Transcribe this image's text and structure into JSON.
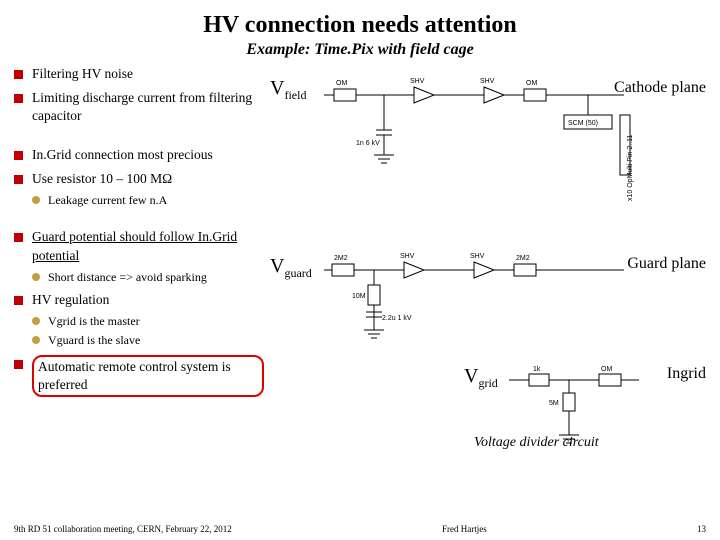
{
  "title": "HV connection needs attention",
  "subtitle": "Example: Time.Pix with field cage",
  "bullets": {
    "b0": "Filtering HV noise",
    "b1": "Limiting discharge current from filtering capacitor",
    "b2": "In.Grid connection most precious",
    "b3": "Use resistor 10 – 100 MΩ",
    "b3s0": "Leakage current few n.A",
    "b4": "Guard potential should follow In.Grid potential",
    "b4s0": "Short distance => avoid sparking",
    "b5": "HV regulation",
    "b5s0": "Vgrid is the master",
    "b5s1": "Vguard is the slave",
    "b6": "Automatic remote control system is preferred"
  },
  "vlabels": {
    "field": "field",
    "guard": "guard",
    "grid": "grid"
  },
  "planes": {
    "cathode": "Cathode plane",
    "guard": "Guard plane",
    "ingrid": "Ingrid"
  },
  "caption": "Voltage divider circuit",
  "schem": {
    "r_om": "OM",
    "r_shv": "SHV",
    "r_2m2": "2M2",
    "cap_1n6kv": "1n 6 kV",
    "scm": "SCM (50)",
    "det_label": "x10 OpMulti Pin 2..11",
    "r_10m": "10M",
    "cap_2u2": "2.2u 1 kV",
    "r_5m": "5M",
    "r_1k": "1k"
  },
  "footer": {
    "left": "9th RD 51 collaboration meeting, CERN, February 22, 2012",
    "center": "Fred Hartjes",
    "right": "13"
  }
}
